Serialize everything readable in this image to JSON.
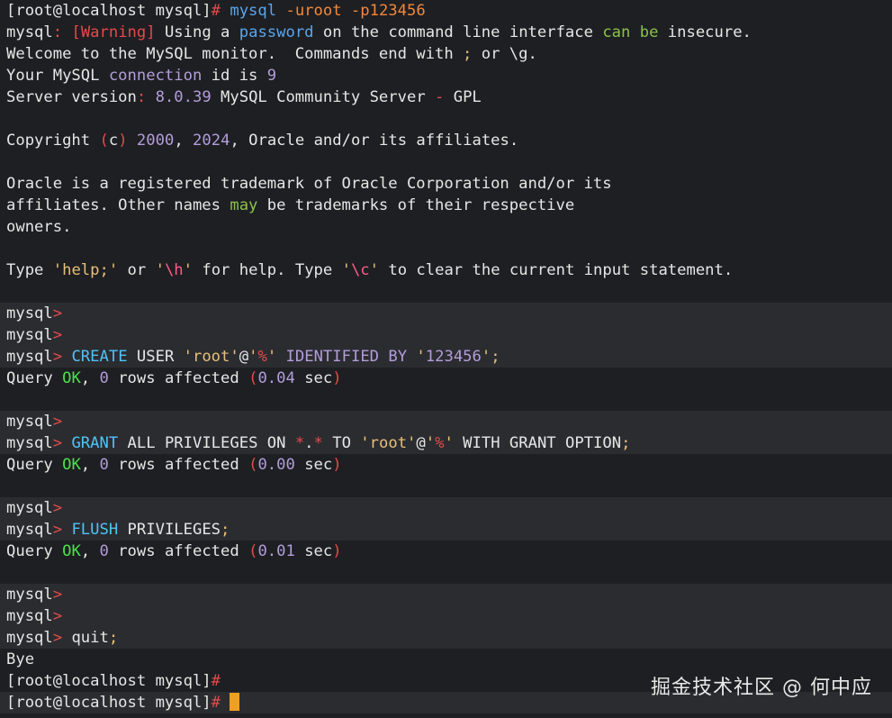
{
  "colors": {
    "background": "#1e1f22",
    "highlight_row": "#2b2c30",
    "default_text": "#e6e6e6",
    "prompt_hash": "#e34b4b",
    "keyword": "#4fc3f7",
    "number": "#b39ddb",
    "string": "#e6c07b",
    "ok": "#4ee04e",
    "cursor": "#f0a020"
  },
  "lines": [
    {
      "hl": false,
      "segments": [
        {
          "t": "[root@localhost mysql]",
          "c": "s-text"
        },
        {
          "t": "# ",
          "c": "s-hash"
        },
        {
          "t": "mysql",
          "c": "s-kwblue"
        },
        {
          "t": " ",
          "c": "s-text"
        },
        {
          "t": "-uroot -p123456",
          "c": "s-flag"
        }
      ]
    },
    {
      "hl": false,
      "segments": [
        {
          "t": "mysql",
          "c": "s-text"
        },
        {
          "t": ": ",
          "c": "s-punct"
        },
        {
          "t": "[",
          "c": "s-punct"
        },
        {
          "t": "Warning",
          "c": "s-warn"
        },
        {
          "t": "]",
          "c": "s-punct"
        },
        {
          "t": " Using a ",
          "c": "s-text"
        },
        {
          "t": "password",
          "c": "s-kwblue"
        },
        {
          "t": " on the command line interface ",
          "c": "s-text"
        },
        {
          "t": "can be",
          "c": "s-green"
        },
        {
          "t": " insecure.",
          "c": "s-text"
        }
      ]
    },
    {
      "hl": false,
      "segments": [
        {
          "t": "Welcome to the MySQL monitor.  Commands end with ",
          "c": "s-text"
        },
        {
          "t": ";",
          "c": "s-str"
        },
        {
          "t": " or \\g.",
          "c": "s-text"
        }
      ]
    },
    {
      "hl": false,
      "segments": [
        {
          "t": "Your MySQL ",
          "c": "s-text"
        },
        {
          "t": "connection",
          "c": "s-kw2"
        },
        {
          "t": " id is ",
          "c": "s-text"
        },
        {
          "t": "9",
          "c": "s-num"
        }
      ]
    },
    {
      "hl": false,
      "segments": [
        {
          "t": "Server version",
          "c": "s-text"
        },
        {
          "t": ": ",
          "c": "s-punct"
        },
        {
          "t": "8.0.39",
          "c": "s-num"
        },
        {
          "t": " MySQL Community Server ",
          "c": "s-text"
        },
        {
          "t": "-",
          "c": "s-punct"
        },
        {
          "t": " GPL",
          "c": "s-text"
        }
      ]
    },
    {
      "hl": false,
      "segments": [
        {
          "t": "",
          "c": "s-text"
        }
      ]
    },
    {
      "hl": false,
      "segments": [
        {
          "t": "Copyright ",
          "c": "s-text"
        },
        {
          "t": "(",
          "c": "s-punct"
        },
        {
          "t": "c",
          "c": "s-text"
        },
        {
          "t": ")",
          "c": "s-punct"
        },
        {
          "t": " ",
          "c": "s-text"
        },
        {
          "t": "2000",
          "c": "s-num"
        },
        {
          "t": ", ",
          "c": "s-text"
        },
        {
          "t": "2024",
          "c": "s-num"
        },
        {
          "t": ", Oracle and/or its affiliates.",
          "c": "s-text"
        }
      ]
    },
    {
      "hl": false,
      "segments": [
        {
          "t": "",
          "c": "s-text"
        }
      ]
    },
    {
      "hl": false,
      "segments": [
        {
          "t": "Oracle is a registered trademark of Oracle Corporation and/or its",
          "c": "s-text"
        }
      ]
    },
    {
      "hl": false,
      "segments": [
        {
          "t": "affiliates. Other names ",
          "c": "s-text"
        },
        {
          "t": "may",
          "c": "s-green"
        },
        {
          "t": " be trademarks of their respective",
          "c": "s-text"
        }
      ]
    },
    {
      "hl": false,
      "segments": [
        {
          "t": "owners.",
          "c": "s-text"
        }
      ]
    },
    {
      "hl": false,
      "segments": [
        {
          "t": "",
          "c": "s-text"
        }
      ]
    },
    {
      "hl": false,
      "segments": [
        {
          "t": "Type ",
          "c": "s-text"
        },
        {
          "t": "'help;'",
          "c": "s-str"
        },
        {
          "t": " or ",
          "c": "s-text"
        },
        {
          "t": "'",
          "c": "s-str"
        },
        {
          "t": "\\h",
          "c": "s-esc"
        },
        {
          "t": "'",
          "c": "s-str"
        },
        {
          "t": " for help. Type ",
          "c": "s-text"
        },
        {
          "t": "'",
          "c": "s-str"
        },
        {
          "t": "\\c",
          "c": "s-esc"
        },
        {
          "t": "'",
          "c": "s-str"
        },
        {
          "t": " to clear the current input statement.",
          "c": "s-text"
        }
      ]
    },
    {
      "hl": false,
      "segments": [
        {
          "t": "",
          "c": "s-text"
        }
      ]
    },
    {
      "hl": true,
      "segments": [
        {
          "t": "mysql",
          "c": "s-text"
        },
        {
          "t": ">",
          "c": "s-op"
        }
      ]
    },
    {
      "hl": true,
      "segments": [
        {
          "t": "mysql",
          "c": "s-text"
        },
        {
          "t": ">",
          "c": "s-op"
        }
      ]
    },
    {
      "hl": true,
      "segments": [
        {
          "t": "mysql",
          "c": "s-text"
        },
        {
          "t": "> ",
          "c": "s-op"
        },
        {
          "t": "CREATE",
          "c": "s-kw"
        },
        {
          "t": " USER ",
          "c": "s-text"
        },
        {
          "t": "'root'",
          "c": "s-str"
        },
        {
          "t": "@",
          "c": "s-text"
        },
        {
          "t": "'",
          "c": "s-str"
        },
        {
          "t": "%",
          "c": "s-op"
        },
        {
          "t": "'",
          "c": "s-str"
        },
        {
          "t": " ",
          "c": "s-text"
        },
        {
          "t": "IDENTIFIED BY",
          "c": "s-kw2"
        },
        {
          "t": " ",
          "c": "s-text"
        },
        {
          "t": "'",
          "c": "s-str"
        },
        {
          "t": "123456",
          "c": "s-num"
        },
        {
          "t": "'",
          "c": "s-str"
        },
        {
          "t": ";",
          "c": "s-str"
        }
      ]
    },
    {
      "hl": false,
      "segments": [
        {
          "t": "Query ",
          "c": "s-text"
        },
        {
          "t": "OK",
          "c": "s-ok"
        },
        {
          "t": ", ",
          "c": "s-text"
        },
        {
          "t": "0",
          "c": "s-num"
        },
        {
          "t": " rows affected ",
          "c": "s-text"
        },
        {
          "t": "(",
          "c": "s-punct"
        },
        {
          "t": "0.04",
          "c": "s-num"
        },
        {
          "t": " sec",
          "c": "s-text"
        },
        {
          "t": ")",
          "c": "s-punct"
        }
      ]
    },
    {
      "hl": false,
      "segments": [
        {
          "t": "",
          "c": "s-text"
        }
      ]
    },
    {
      "hl": true,
      "segments": [
        {
          "t": "mysql",
          "c": "s-text"
        },
        {
          "t": ">",
          "c": "s-op"
        }
      ]
    },
    {
      "hl": true,
      "segments": [
        {
          "t": "mysql",
          "c": "s-text"
        },
        {
          "t": "> ",
          "c": "s-op"
        },
        {
          "t": "GRANT",
          "c": "s-kw"
        },
        {
          "t": " ALL PRIVILEGES ON ",
          "c": "s-text"
        },
        {
          "t": "*",
          "c": "s-op"
        },
        {
          "t": ".",
          "c": "s-text"
        },
        {
          "t": "*",
          "c": "s-op"
        },
        {
          "t": " TO ",
          "c": "s-text"
        },
        {
          "t": "'root'",
          "c": "s-str"
        },
        {
          "t": "@",
          "c": "s-text"
        },
        {
          "t": "'",
          "c": "s-str"
        },
        {
          "t": "%",
          "c": "s-op"
        },
        {
          "t": "'",
          "c": "s-str"
        },
        {
          "t": " WITH GRANT OPTION",
          "c": "s-text"
        },
        {
          "t": ";",
          "c": "s-str"
        }
      ]
    },
    {
      "hl": false,
      "segments": [
        {
          "t": "Query ",
          "c": "s-text"
        },
        {
          "t": "OK",
          "c": "s-ok"
        },
        {
          "t": ", ",
          "c": "s-text"
        },
        {
          "t": "0",
          "c": "s-num"
        },
        {
          "t": " rows affected ",
          "c": "s-text"
        },
        {
          "t": "(",
          "c": "s-punct"
        },
        {
          "t": "0.00",
          "c": "s-num"
        },
        {
          "t": " sec",
          "c": "s-text"
        },
        {
          "t": ")",
          "c": "s-punct"
        }
      ]
    },
    {
      "hl": false,
      "segments": [
        {
          "t": "",
          "c": "s-text"
        }
      ]
    },
    {
      "hl": true,
      "segments": [
        {
          "t": "mysql",
          "c": "s-text"
        },
        {
          "t": ">",
          "c": "s-op"
        }
      ]
    },
    {
      "hl": true,
      "segments": [
        {
          "t": "mysql",
          "c": "s-text"
        },
        {
          "t": "> ",
          "c": "s-op"
        },
        {
          "t": "FLUSH",
          "c": "s-kw"
        },
        {
          "t": " PRIVILEGES",
          "c": "s-text"
        },
        {
          "t": ";",
          "c": "s-str"
        }
      ]
    },
    {
      "hl": false,
      "segments": [
        {
          "t": "Query ",
          "c": "s-text"
        },
        {
          "t": "OK",
          "c": "s-ok"
        },
        {
          "t": ", ",
          "c": "s-text"
        },
        {
          "t": "0",
          "c": "s-num"
        },
        {
          "t": " rows affected ",
          "c": "s-text"
        },
        {
          "t": "(",
          "c": "s-punct"
        },
        {
          "t": "0.01",
          "c": "s-num"
        },
        {
          "t": " sec",
          "c": "s-text"
        },
        {
          "t": ")",
          "c": "s-punct"
        }
      ]
    },
    {
      "hl": false,
      "segments": [
        {
          "t": "",
          "c": "s-text"
        }
      ]
    },
    {
      "hl": true,
      "segments": [
        {
          "t": "mysql",
          "c": "s-text"
        },
        {
          "t": ">",
          "c": "s-op"
        }
      ]
    },
    {
      "hl": true,
      "segments": [
        {
          "t": "mysql",
          "c": "s-text"
        },
        {
          "t": ">",
          "c": "s-op"
        }
      ]
    },
    {
      "hl": true,
      "segments": [
        {
          "t": "mysql",
          "c": "s-text"
        },
        {
          "t": "> ",
          "c": "s-op"
        },
        {
          "t": "quit",
          "c": "s-text"
        },
        {
          "t": ";",
          "c": "s-str"
        }
      ]
    },
    {
      "hl": false,
      "segments": [
        {
          "t": "Bye",
          "c": "s-text"
        }
      ]
    },
    {
      "hl": false,
      "segments": [
        {
          "t": "[root@localhost mysql]",
          "c": "s-text"
        },
        {
          "t": "#",
          "c": "s-hash"
        }
      ]
    },
    {
      "hl": true,
      "cursor": true,
      "segments": [
        {
          "t": "[root@localhost mysql]",
          "c": "s-text"
        },
        {
          "t": "# ",
          "c": "s-hash"
        }
      ]
    }
  ],
  "watermark": "掘金技术社区 @ 何中应"
}
